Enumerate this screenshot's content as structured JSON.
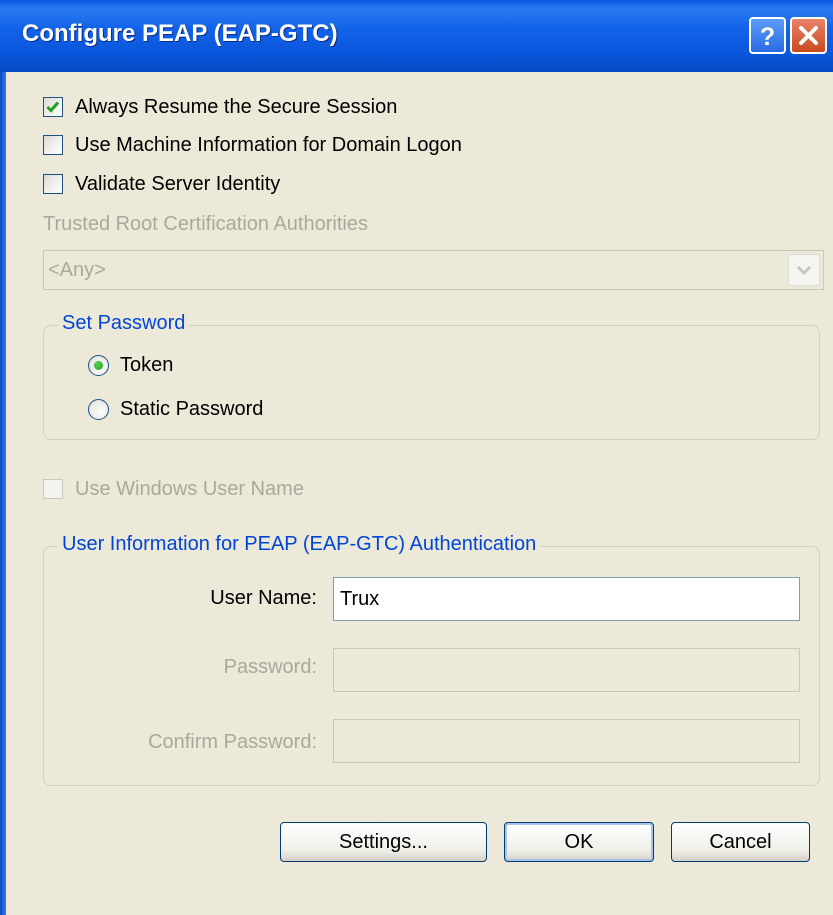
{
  "window": {
    "title": "Configure PEAP (EAP-GTC)",
    "help_label": "?",
    "titlebar_color": "#0a58e0",
    "face_color": "#ece9d8"
  },
  "options": {
    "always_resume": {
      "label": "Always Resume the Secure Session",
      "checked": true
    },
    "machine_info": {
      "label": "Use Machine Information for Domain Logon",
      "checked": false
    },
    "validate_server": {
      "label": "Validate Server Identity",
      "checked": false
    }
  },
  "trusted_root": {
    "label": "Trusted Root Certification Authorities",
    "value": "<Any>",
    "enabled": false
  },
  "set_password": {
    "title": "Set Password",
    "token_label": "Token",
    "static_label": "Static Password",
    "selected": "Token"
  },
  "use_windows_user": {
    "label": "Use Windows User Name",
    "checked": false,
    "enabled": false
  },
  "user_info": {
    "title": "User Information for PEAP (EAP-GTC) Authentication",
    "username_label": "User Name:",
    "username_value": "Trux",
    "password_label": "Password:",
    "password_value": "",
    "confirm_label": "Confirm Password:",
    "confirm_value": ""
  },
  "buttons": {
    "settings": "Settings...",
    "ok": "OK",
    "cancel": "Cancel"
  },
  "colors": {
    "group_title": "#0046d5",
    "disabled_text": "#aca899",
    "checkmark": "#21a121"
  }
}
